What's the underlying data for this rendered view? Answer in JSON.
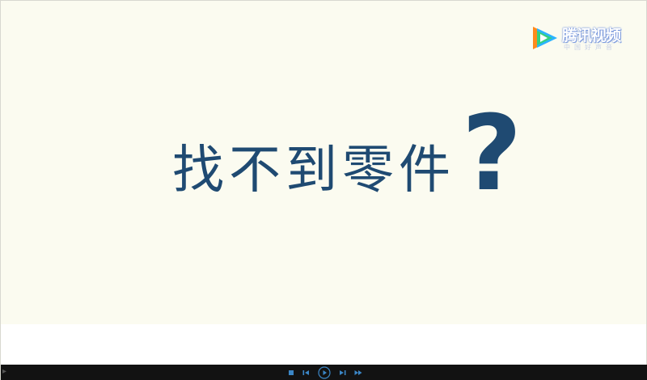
{
  "watermark": {
    "brand": "腾讯视频",
    "sub": "中国好声音"
  },
  "slide": {
    "headline": "找不到零件",
    "qmark": "?"
  },
  "player": {
    "left_indicator": "▸",
    "buttons": [
      "stop",
      "previous",
      "play-pause",
      "next",
      "fast-forward"
    ]
  },
  "colors": {
    "background": "#fafaf0",
    "text": "#1f4a72",
    "bar": "#121212",
    "controls": "#3b86c6"
  }
}
